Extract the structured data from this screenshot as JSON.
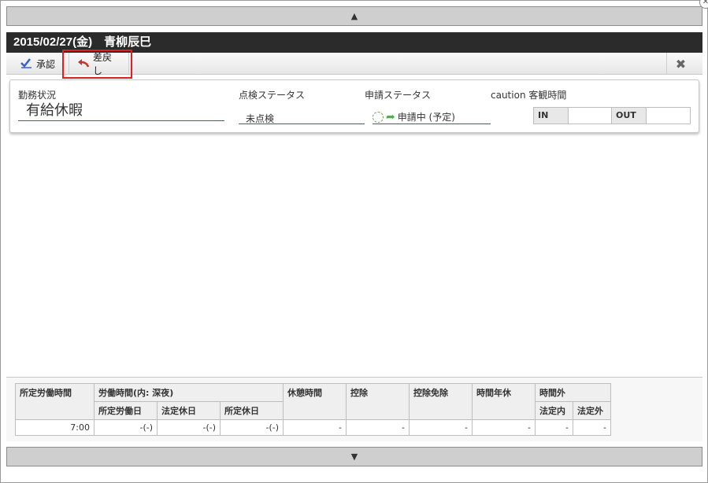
{
  "scroll": {
    "up_glyph": "▲",
    "down_glyph": "▼"
  },
  "window": {
    "corner_close_glyph": "✕"
  },
  "header": {
    "title": "2015/02/27(金)　青柳辰巳"
  },
  "toolbar": {
    "approve_label": "承認",
    "return_label": "差戻し",
    "close_glyph": "✖"
  },
  "status": {
    "work_status_label": "勤務状況",
    "work_status_value": "有給休暇",
    "check_status_label": "点検ステータス",
    "check_status_value": "未点検",
    "app_status_label": "申請ステータス",
    "app_status_value": "申請中 (予定)",
    "objective_time_label": "caution 客観時間",
    "in_label": "IN",
    "out_label": "OUT"
  },
  "summary": {
    "headers": {
      "scheduled": "所定労働時間",
      "working": "労働時間(内: 深夜)",
      "working_scheduled_day": "所定労働日",
      "working_legal_holiday": "法定休日",
      "working_scheduled_holiday": "所定休日",
      "break": "休憩時間",
      "deduction": "控除",
      "deduction_exempt": "控除免除",
      "hourly_leave": "時間年休",
      "overtime": "時間外",
      "overtime_within_legal": "法定内",
      "overtime_over_legal": "法定外"
    },
    "row": {
      "scheduled": "7:00",
      "working_scheduled_day": "-(-)",
      "working_legal_holiday": "-(-)",
      "working_scheduled_holiday": "-(-)",
      "break": "-",
      "deduction": "-",
      "deduction_exempt": "-",
      "hourly_leave": "-",
      "overtime_within_legal": "-",
      "overtime_over_legal": "-"
    }
  }
}
